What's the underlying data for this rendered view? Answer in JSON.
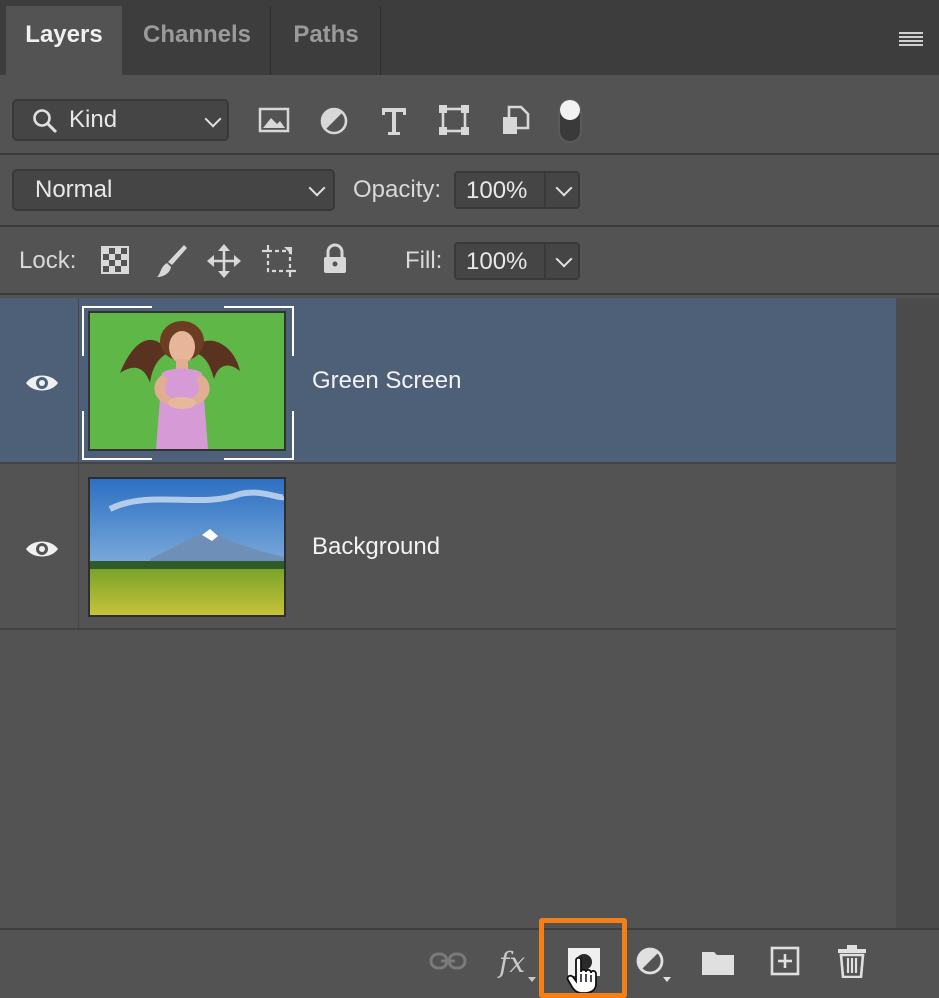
{
  "tabs": [
    {
      "label": "Layers",
      "active": true
    },
    {
      "label": "Channels",
      "active": false
    },
    {
      "label": "Paths",
      "active": false
    }
  ],
  "filter": {
    "kind_label": "Kind",
    "icons": [
      "image-filter-icon",
      "adjustment-filter-icon",
      "type-filter-icon",
      "shape-filter-icon",
      "smart-object-filter-icon",
      "filter-toggle-icon"
    ]
  },
  "blend": {
    "mode": "Normal",
    "opacity_label": "Opacity:",
    "opacity_value": "100%"
  },
  "lock": {
    "label": "Lock:",
    "icons": [
      "lock-transparent-pixels-icon",
      "lock-image-pixels-icon",
      "lock-position-icon",
      "lock-artboard-icon",
      "lock-all-icon"
    ],
    "fill_label": "Fill:",
    "fill_value": "100%"
  },
  "layers": [
    {
      "name": "Green Screen",
      "selected": true,
      "thumbnail": "woman-on-green-screen"
    },
    {
      "name": "Background",
      "selected": false,
      "thumbnail": "mountain-meadow-landscape"
    }
  ],
  "bottom_icons": [
    "link-layers-icon",
    "fx-icon",
    "add-layer-mask-icon",
    "adjustment-layer-icon",
    "new-group-icon",
    "new-layer-icon",
    "delete-layer-icon"
  ],
  "colors": {
    "panel_bg": "#535353",
    "selected_layer": "#4e6078",
    "highlight": "#f57f17"
  }
}
